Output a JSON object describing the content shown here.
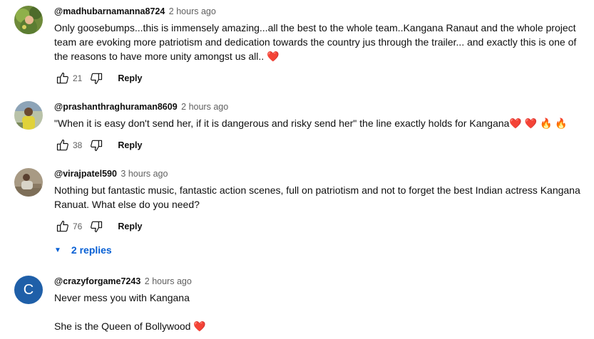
{
  "comments": [
    {
      "author": "@madhubarnamanna8724",
      "time": "2 hours ago",
      "text": "Only goosebumps...this is immensely amazing...all the best to the whole team..Kangana Ranaut and the whole project team are evoking more patriotism and dedication towards the country jus through the trailer... and exactly this is one of the reasons to have more unity amongst us all.. ",
      "emoji": "❤️",
      "likes": "21",
      "reply_label": "Reply"
    },
    {
      "author": "@prashanthraghuraman8609",
      "time": "2 hours ago",
      "text": "\"When it is easy don't send her, if it is dangerous and risky send her\" the line exactly holds for Kangana",
      "emoji": "❤️ ❤️ 🔥 🔥",
      "likes": "38",
      "reply_label": "Reply"
    },
    {
      "author": "@virajpatel590",
      "time": "3 hours ago",
      "text": "Nothing but fantastic music, fantastic action scenes, full on patriotism and not to forget the best Indian actress Kangana Ranuat. What else do you need?",
      "likes": "76",
      "reply_label": "Reply",
      "replies_label": "2 replies"
    },
    {
      "author": "@crazyforgame7243",
      "time": "2 hours ago",
      "avatar_letter": "C",
      "avatar_color": "#1f5fa8",
      "line1": "Never mess you with Kangana",
      "line2": "She is the Queen of Bollywood ",
      "emoji": "❤️"
    }
  ],
  "icons": {
    "like": "thumbs-up-icon",
    "dislike": "thumbs-down-icon",
    "expand": "caret-down-icon"
  },
  "colors": {
    "link_blue": "#065fd4",
    "secondary_text": "#606060",
    "heart": "#e02a2a"
  }
}
